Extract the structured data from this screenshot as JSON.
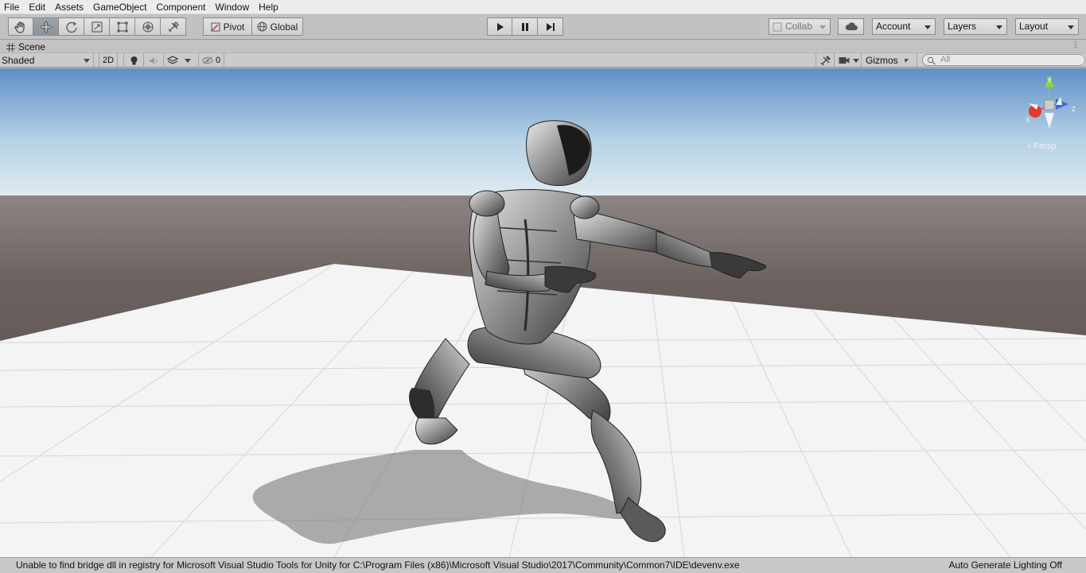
{
  "menu": [
    "File",
    "Edit",
    "Assets",
    "GameObject",
    "Component",
    "Window",
    "Help"
  ],
  "toolbar": {
    "tools": [
      {
        "name": "hand-tool-icon"
      },
      {
        "name": "move-tool-icon",
        "active": true
      },
      {
        "name": "rotate-tool-icon"
      },
      {
        "name": "scale-tool-icon"
      },
      {
        "name": "rect-tool-icon"
      },
      {
        "name": "transform-tool-icon"
      },
      {
        "name": "custom-tool-icon"
      }
    ],
    "pivot_label": "Pivot",
    "global_label": "Global",
    "collab_label": "Collab",
    "account_label": "Account",
    "layers_label": "Layers",
    "layout_label": "Layout"
  },
  "scene_tab": {
    "title": "Scene"
  },
  "scene_toolbar": {
    "shading_mode": "Shaded",
    "mode_2d": "2D",
    "hidden_count": "0",
    "gizmos_label": "Gizmos",
    "search_placeholder": "All"
  },
  "viewport": {
    "projection_label": "Persp",
    "gizmo_axes": [
      "Y",
      "Z",
      "X"
    ],
    "colors": {
      "sky_top": "#5f8fc6",
      "sky_horizon": "#d9e8f2",
      "ground": "#5e5552",
      "plane": "#f4f4f4",
      "x_axis": "#e23a2c",
      "y_axis": "#8fd24a",
      "z_axis": "#3a6fe2"
    }
  },
  "status": {
    "message": "Unable to find bridge dll in registry for Microsoft Visual Studio Tools for Unity for C:\\Program Files (x86)\\Microsoft Visual Studio\\2017\\Community\\Common7\\IDE\\devenv.exe",
    "lighting": "Auto Generate Lighting Off"
  }
}
